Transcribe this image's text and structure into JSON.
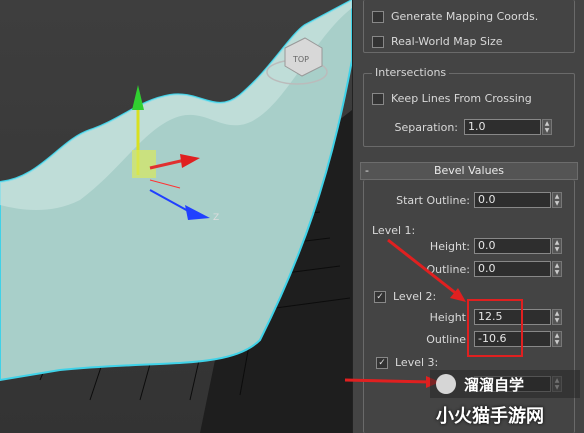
{
  "viewport": {
    "cube_label": "TOP",
    "axis_label": "Z"
  },
  "mapping": {
    "generate_label": "Generate Mapping Coords.",
    "realworld_label": "Real-World Map Size"
  },
  "intersections": {
    "title": "Intersections",
    "keep_lines_label": "Keep Lines From Crossing",
    "separation_label": "Separation:",
    "separation_value": "1.0"
  },
  "bevel": {
    "rollout_title": "Bevel Values",
    "rollout_toggle": "-",
    "start_outline_label": "Start Outline:",
    "start_outline_value": "0.0",
    "level1_label": "Level 1:",
    "level1_height_label": "Height:",
    "level1_height_value": "0.0",
    "level1_outline_label": "Outline:",
    "level1_outline_value": "0.0",
    "level2_label": "Level 2:",
    "level2_checked": true,
    "level2_height_label": "Height",
    "level2_height_value": "12.5",
    "level2_outline_label": "Outline",
    "level2_outline_value": "-10.6",
    "level3_label": "Level 3:",
    "level3_checked": true
  },
  "watermark": {
    "brand": "溜溜自学",
    "site": "小火猫手游网"
  },
  "colors": {
    "highlight": "#e02020",
    "surface": "#a8cfc9",
    "outline": "#3fd2e8"
  }
}
